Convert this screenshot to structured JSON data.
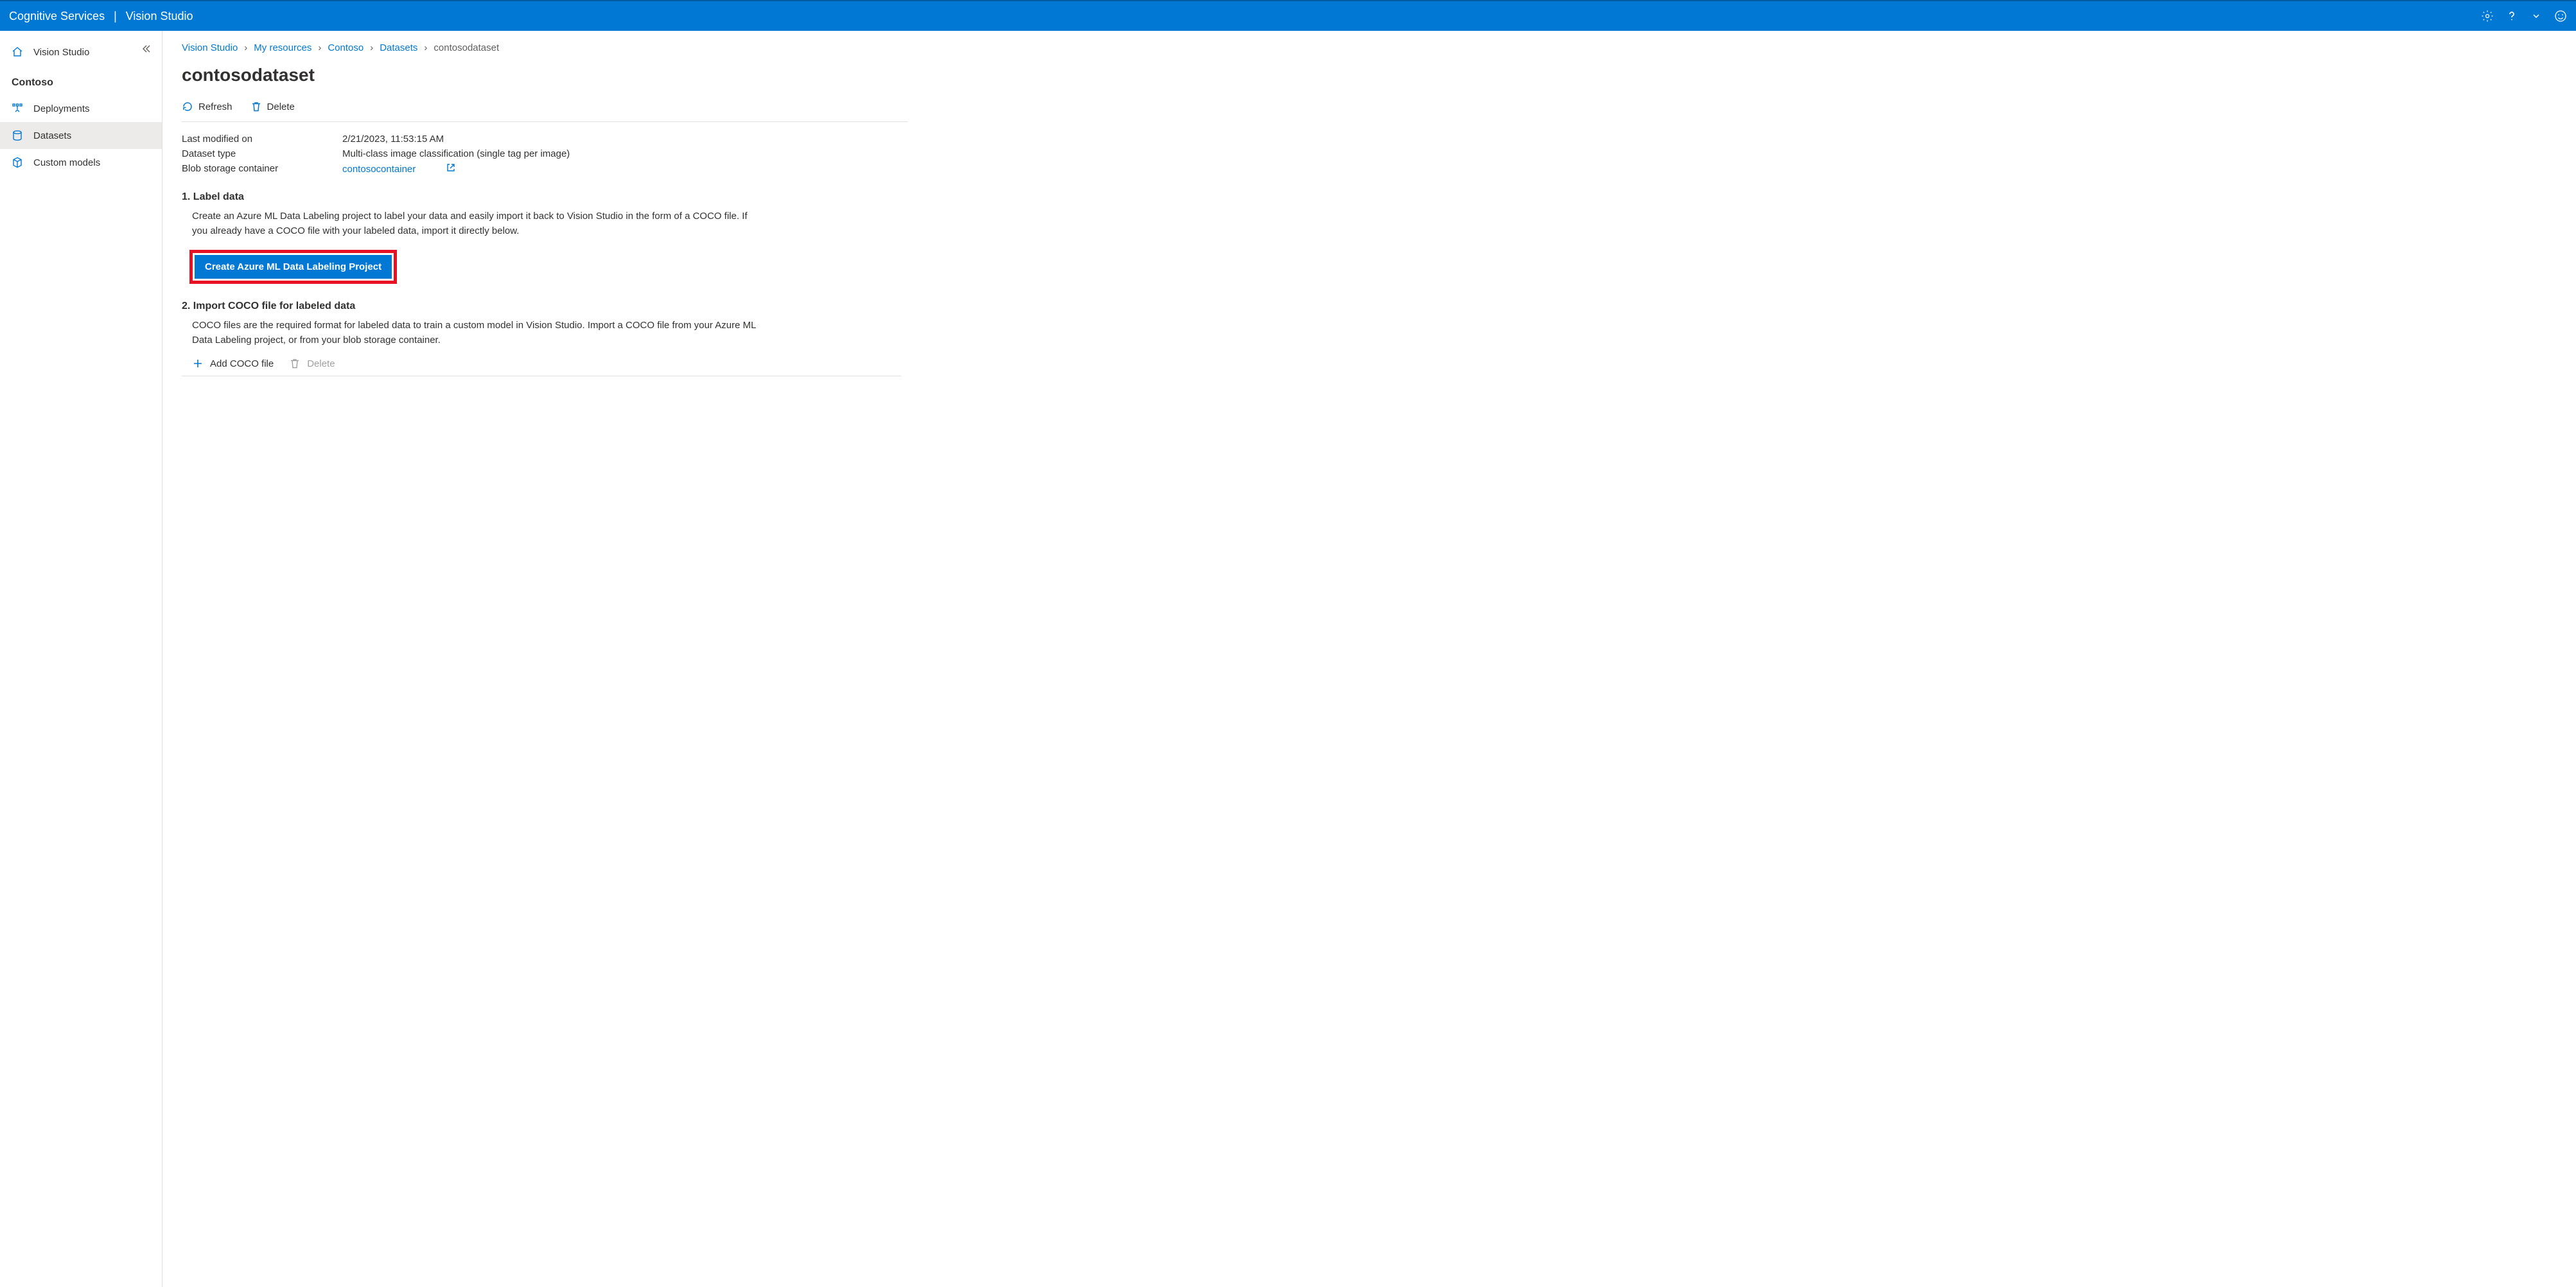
{
  "header": {
    "brand": "Cognitive Services",
    "product": "Vision Studio"
  },
  "sidebar": {
    "home_label": "Vision Studio",
    "resource_name": "Contoso",
    "items": [
      {
        "label": "Deployments"
      },
      {
        "label": "Datasets"
      },
      {
        "label": "Custom models"
      }
    ]
  },
  "breadcrumb": {
    "items": [
      {
        "label": "Vision Studio"
      },
      {
        "label": "My resources"
      },
      {
        "label": "Contoso"
      },
      {
        "label": "Datasets"
      }
    ],
    "current": "contosodataset"
  },
  "page": {
    "title": "contosodataset"
  },
  "toolbar": {
    "refresh": "Refresh",
    "delete": "Delete"
  },
  "meta": {
    "last_modified_label": "Last modified on",
    "last_modified_value": "2/21/2023, 11:53:15 AM",
    "dataset_type_label": "Dataset type",
    "dataset_type_value": "Multi-class image classification (single tag per image)",
    "blob_label": "Blob storage container",
    "blob_value": "contosocontainer"
  },
  "section1": {
    "heading": "1. Label data",
    "body": "Create an Azure ML Data Labeling project to label your data and easily import it back to Vision Studio in the form of a COCO file. If you already have a COCO file with your labeled data, import it directly below.",
    "button": "Create Azure ML Data Labeling Project"
  },
  "section2": {
    "heading": "2. Import COCO file for labeled data",
    "body": "COCO files are the required format for labeled data to train a custom model in Vision Studio. Import a COCO file from your Azure ML Data Labeling project, or from your blob storage container.",
    "add_label": "Add COCO file",
    "delete_label": "Delete"
  }
}
